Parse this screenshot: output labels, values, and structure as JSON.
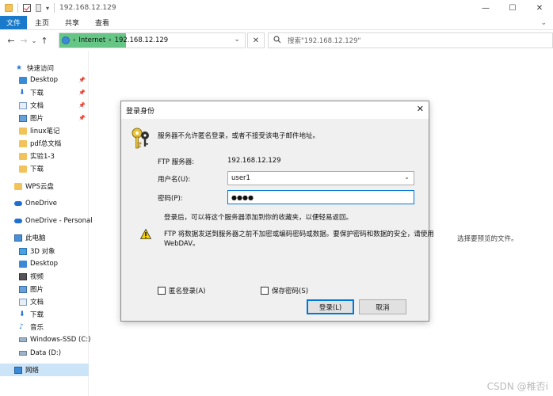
{
  "window": {
    "title": "192.168.12.129",
    "controls": [
      "—",
      "☐",
      "✕"
    ]
  },
  "ribbon": {
    "tabs": [
      "文件",
      "主页",
      "共享",
      "查看"
    ],
    "expand": "⌄"
  },
  "nav": {
    "back": "←",
    "forward": "→",
    "recent": "⌄",
    "up": "↑",
    "breadcrumb_sep": "›",
    "location_root": "Internet",
    "location_host": "192.168.12.129",
    "address_dropdown": "⌄",
    "address_clear": "✕",
    "search_placeholder": "搜索\"192.168.12.129\""
  },
  "sidebar": {
    "quick_access": "快速访问",
    "items": [
      {
        "label": "Desktop",
        "icon": "folder-blue-icon",
        "pinned": true
      },
      {
        "label": "下载",
        "icon": "download-icon",
        "pinned": true
      },
      {
        "label": "文档",
        "icon": "document-icon",
        "pinned": true
      },
      {
        "label": "图片",
        "icon": "picture-icon",
        "pinned": true
      },
      {
        "label": "linux笔记",
        "icon": "folder-icon",
        "pinned": false
      },
      {
        "label": "pdf总文档",
        "icon": "folder-icon",
        "pinned": false
      },
      {
        "label": "实验1-3",
        "icon": "folder-icon",
        "pinned": false
      },
      {
        "label": "下载",
        "icon": "folder-icon",
        "pinned": false
      }
    ],
    "wps": "WPS云盘",
    "onedrive": "OneDrive",
    "onedrive_personal": "OneDrive - Personal",
    "this_pc": "此电脑",
    "pc_items": [
      {
        "label": "3D 对象",
        "icon": "cube-icon"
      },
      {
        "label": "Desktop",
        "icon": "folder-blue-icon"
      },
      {
        "label": "视频",
        "icon": "video-icon"
      },
      {
        "label": "图片",
        "icon": "picture-icon"
      },
      {
        "label": "文档",
        "icon": "document-icon"
      },
      {
        "label": "下载",
        "icon": "download-icon"
      },
      {
        "label": "音乐",
        "icon": "music-icon"
      },
      {
        "label": "Windows-SSD (C:)",
        "icon": "drive-icon"
      },
      {
        "label": "Data (D:)",
        "icon": "drive-icon"
      }
    ],
    "network": "网络"
  },
  "preview_text": "选择要预览的文件。",
  "dialog": {
    "title": "登录身份",
    "close": "✕",
    "message": "服务器不允许匿名登录，或者不接受该电子邮件地址。",
    "ftp_server_label": "FTP 服务器:",
    "ftp_server_value": "192.168.12.129",
    "username_label": "用户名(U):",
    "username_value": "user1",
    "password_label": "密码(P):",
    "password_value": "●●●●",
    "add_favorites_note": "登录后，可以将这个服务器添加到你的收藏夹，以便轻易返回。",
    "warning_line1": "FTP 将数据发送到服务器之前不加密或编码密码或数据。要保护密码和数据的安全，请使用",
    "warning_line2": "WebDAV。",
    "anonymous_label": "匿名登录(A)",
    "anonymous_checked": false,
    "save_password_label": "保存密码(S)",
    "save_password_checked": false,
    "login_button": "登录(L)",
    "cancel_button": "取消"
  },
  "watermark": "CSDN @稚否i"
}
